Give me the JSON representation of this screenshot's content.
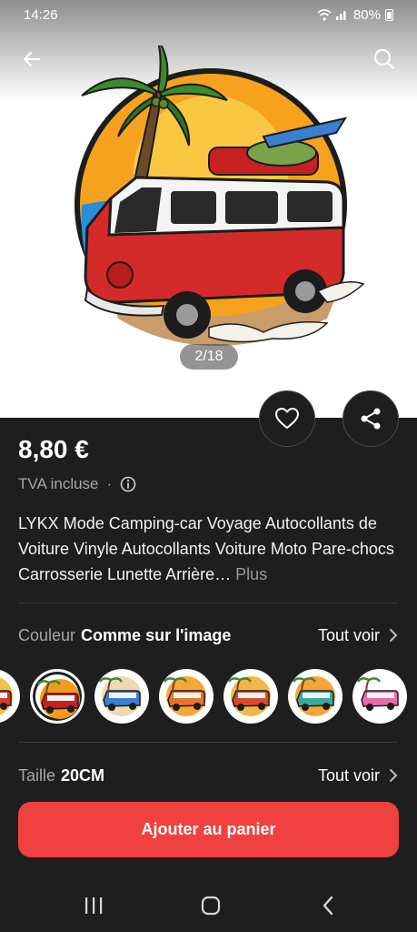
{
  "status_bar": {
    "time": "14:26",
    "battery": "80%"
  },
  "hero": {
    "counter": "2/18"
  },
  "product": {
    "price": "8,80 €",
    "vat": "TVA incluse",
    "title": "LYKX Mode Camping-car Voyage Autocollants de Voiture Vinyle Autocollants Voiture Moto Pare-chocs Carrosserie Lunette Arrière…",
    "more": "Plus"
  },
  "color_option": {
    "label": "Couleur",
    "value": "Comme sur l'image",
    "see_all": "Tout voir"
  },
  "size_option": {
    "label": "Taille",
    "value": "20CM",
    "see_all": "Tout voir"
  },
  "swatches": [
    {
      "name": "swatch-variant-0",
      "bg": "#f3c14a",
      "body": "#d43a2f",
      "selected": false
    },
    {
      "name": "swatch-variant-1",
      "bg": "#f59a1c",
      "body": "#c82020",
      "selected": true
    },
    {
      "name": "swatch-variant-2",
      "bg": "#f0d9b0",
      "body": "#3a7fd0",
      "selected": false
    },
    {
      "name": "swatch-variant-3",
      "bg": "#f6a63a",
      "body": "#e8742a",
      "selected": false
    },
    {
      "name": "swatch-variant-4",
      "bg": "#f2b64a",
      "body": "#d84a2a",
      "selected": false
    },
    {
      "name": "swatch-variant-5",
      "bg": "#f7a53a",
      "body": "#3aa8a0",
      "selected": false
    },
    {
      "name": "swatch-variant-6",
      "bg": "#ffffff",
      "body": "#e86ab0",
      "selected": false
    },
    {
      "name": "swatch-variant-7",
      "bg": "#f5f5f5",
      "body": "#d0d0d0",
      "selected": false
    }
  ],
  "cta": {
    "label": "Ajouter au panier"
  },
  "colors": {
    "background": "#1e1e1e",
    "accent": "#f04040",
    "muted": "#a6a6a6"
  }
}
